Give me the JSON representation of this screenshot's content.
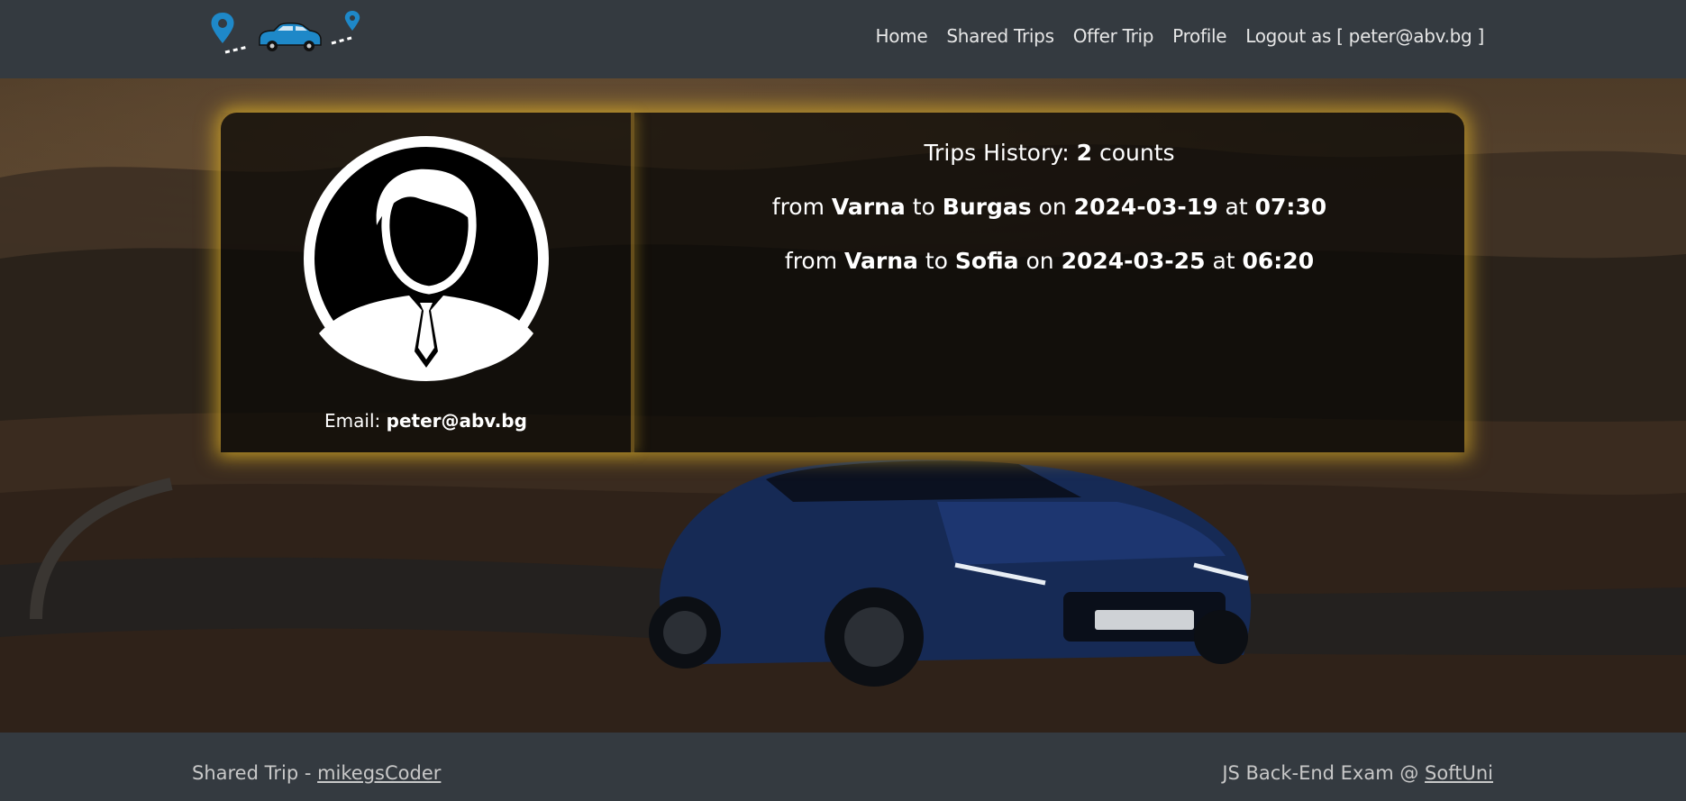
{
  "nav": {
    "home": "Home",
    "shared_trips": "Shared Trips",
    "offer_trip": "Offer Trip",
    "profile": "Profile",
    "logout": "Logout as [ peter@abv.bg ]"
  },
  "profile": {
    "email_label": "Email:",
    "email": "peter@abv.bg"
  },
  "history": {
    "label": "Trips History:",
    "count": "2",
    "suffix": "counts",
    "trips": [
      {
        "from": "Varna",
        "to": "Burgas",
        "date": "2024-03-19",
        "time": "07:30"
      },
      {
        "from": "Varna",
        "to": "Sofia",
        "date": "2024-03-25",
        "time": "06:20"
      }
    ],
    "word_from": "from",
    "word_to": "to",
    "word_on": "on",
    "word_at": "at"
  },
  "footer": {
    "left_text": "Shared Trip -",
    "left_link": "mikegsCoder",
    "right_text": "JS Back-End Exam @",
    "right_link": "SoftUni"
  },
  "colors": {
    "header_bg": "#343a40",
    "card_glow": "#d6aa28",
    "logo_blue": "#1e88c8"
  }
}
